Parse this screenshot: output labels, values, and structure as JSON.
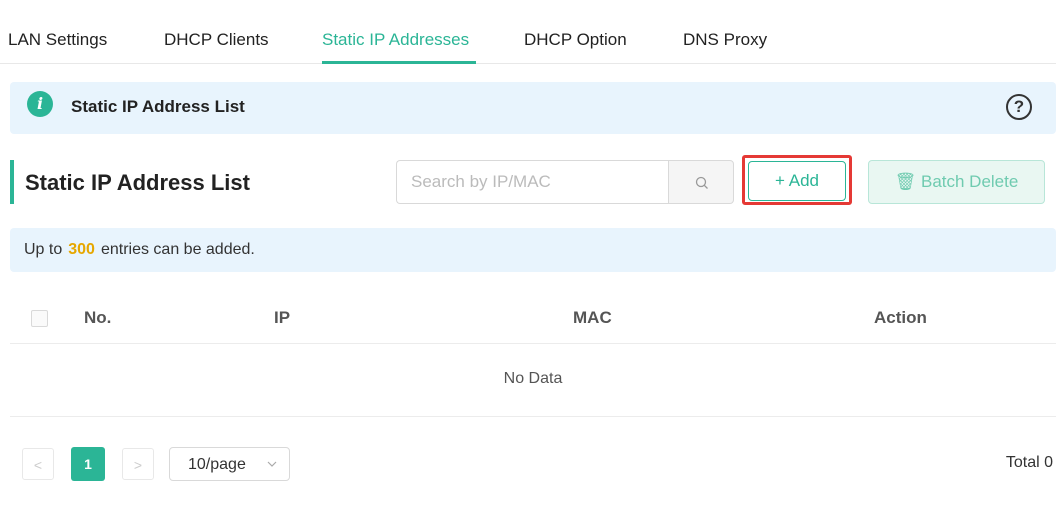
{
  "tabs": [
    {
      "label": "LAN Settings"
    },
    {
      "label": "DHCP Clients"
    },
    {
      "label": "Static IP Addresses"
    },
    {
      "label": "DHCP Option"
    },
    {
      "label": "DNS Proxy"
    }
  ],
  "active_tab": "Static IP Addresses",
  "banner": {
    "icon": "info-icon",
    "title": "Static IP Address List",
    "help_icon": "help-icon",
    "help_glyph": "?"
  },
  "section": {
    "title": "Static IP Address List"
  },
  "search": {
    "placeholder": "Search by IP/MAC",
    "value": ""
  },
  "buttons": {
    "add_label": "+ Add",
    "batch_delete_label": "🗑 Batch Delete"
  },
  "note": {
    "prefix": "Up to",
    "count": "300",
    "suffix": "entries can be added."
  },
  "table": {
    "columns": [
      "No.",
      "IP",
      "MAC",
      "Action"
    ],
    "rows": [],
    "empty_text": "No Data"
  },
  "pagination": {
    "prev": "<",
    "current_page": "1",
    "next": ">",
    "page_size": "10/page",
    "total": "Total 0"
  },
  "colors": {
    "accent": "#2bb596",
    "highlight": "#e53935",
    "banner_bg": "#e8f4fd",
    "count": "#e6a700"
  }
}
